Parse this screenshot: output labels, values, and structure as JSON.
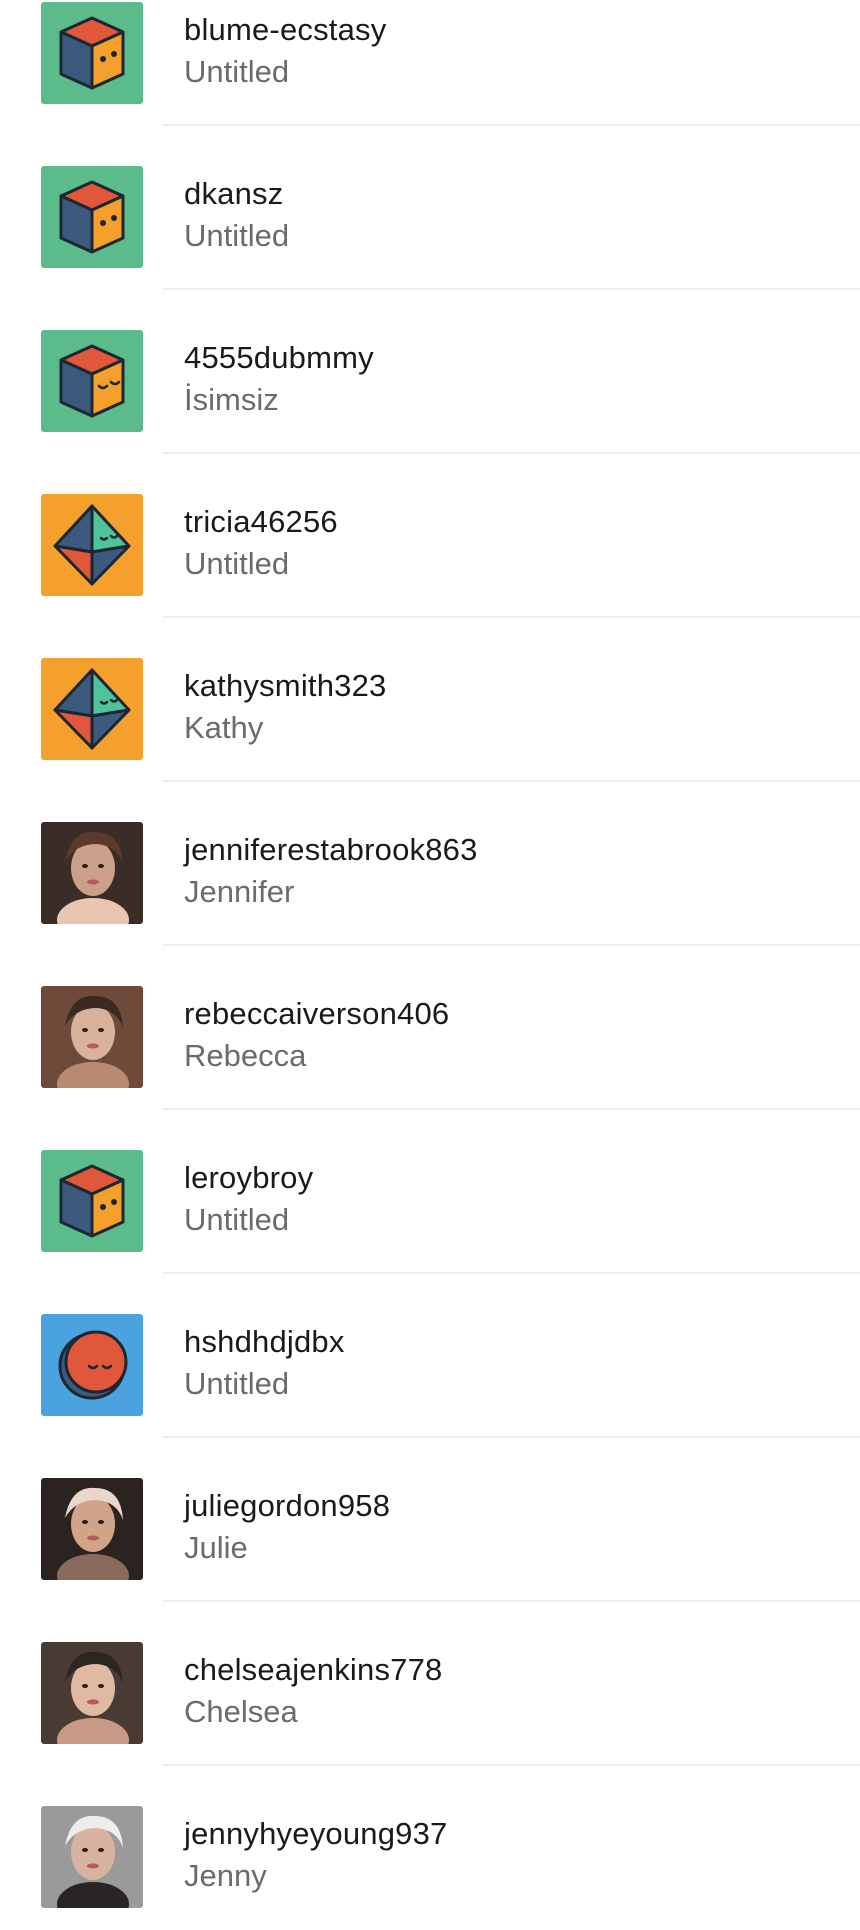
{
  "colors": {
    "green": "#5bbb8b",
    "orange": "#f5a02c",
    "blue": "#4aa3de",
    "cube_top": "#e1573a",
    "cube_left": "#3b5a7e",
    "cube_right": "#f5a02c",
    "outline": "#1b2733"
  },
  "users": [
    {
      "username": "blume-ecstasy",
      "title": "Untitled",
      "avatar": "cube-icon",
      "bg": "green"
    },
    {
      "username": "dkansz",
      "title": "Untitled",
      "avatar": "cube-icon",
      "bg": "green"
    },
    {
      "username": "4555dubmmy",
      "title": "İsimsiz",
      "avatar": "cube-sleepy-icon",
      "bg": "green"
    },
    {
      "username": "tricia46256",
      "title": "Untitled",
      "avatar": "octahedron-icon",
      "bg": "orange"
    },
    {
      "username": "kathysmith323",
      "title": "Kathy",
      "avatar": "octahedron-icon",
      "bg": "orange"
    },
    {
      "username": "jenniferestabrook863",
      "title": "Jennifer",
      "avatar": "profile-photo",
      "bg": "photo"
    },
    {
      "username": "rebeccaiverson406",
      "title": "Rebecca",
      "avatar": "profile-photo",
      "bg": "photo"
    },
    {
      "username": "leroybroy",
      "title": "Untitled",
      "avatar": "cube-icon",
      "bg": "green"
    },
    {
      "username": "hshdhdjdbx",
      "title": "Untitled",
      "avatar": "moon-face-icon",
      "bg": "blue"
    },
    {
      "username": "juliegordon958",
      "title": "Julie",
      "avatar": "profile-photo",
      "bg": "photo"
    },
    {
      "username": "chelseajenkins778",
      "title": "Chelsea",
      "avatar": "profile-photo",
      "bg": "photo"
    },
    {
      "username": "jennyhyeyoung937",
      "title": "Jenny",
      "avatar": "profile-photo",
      "bg": "photo"
    }
  ]
}
